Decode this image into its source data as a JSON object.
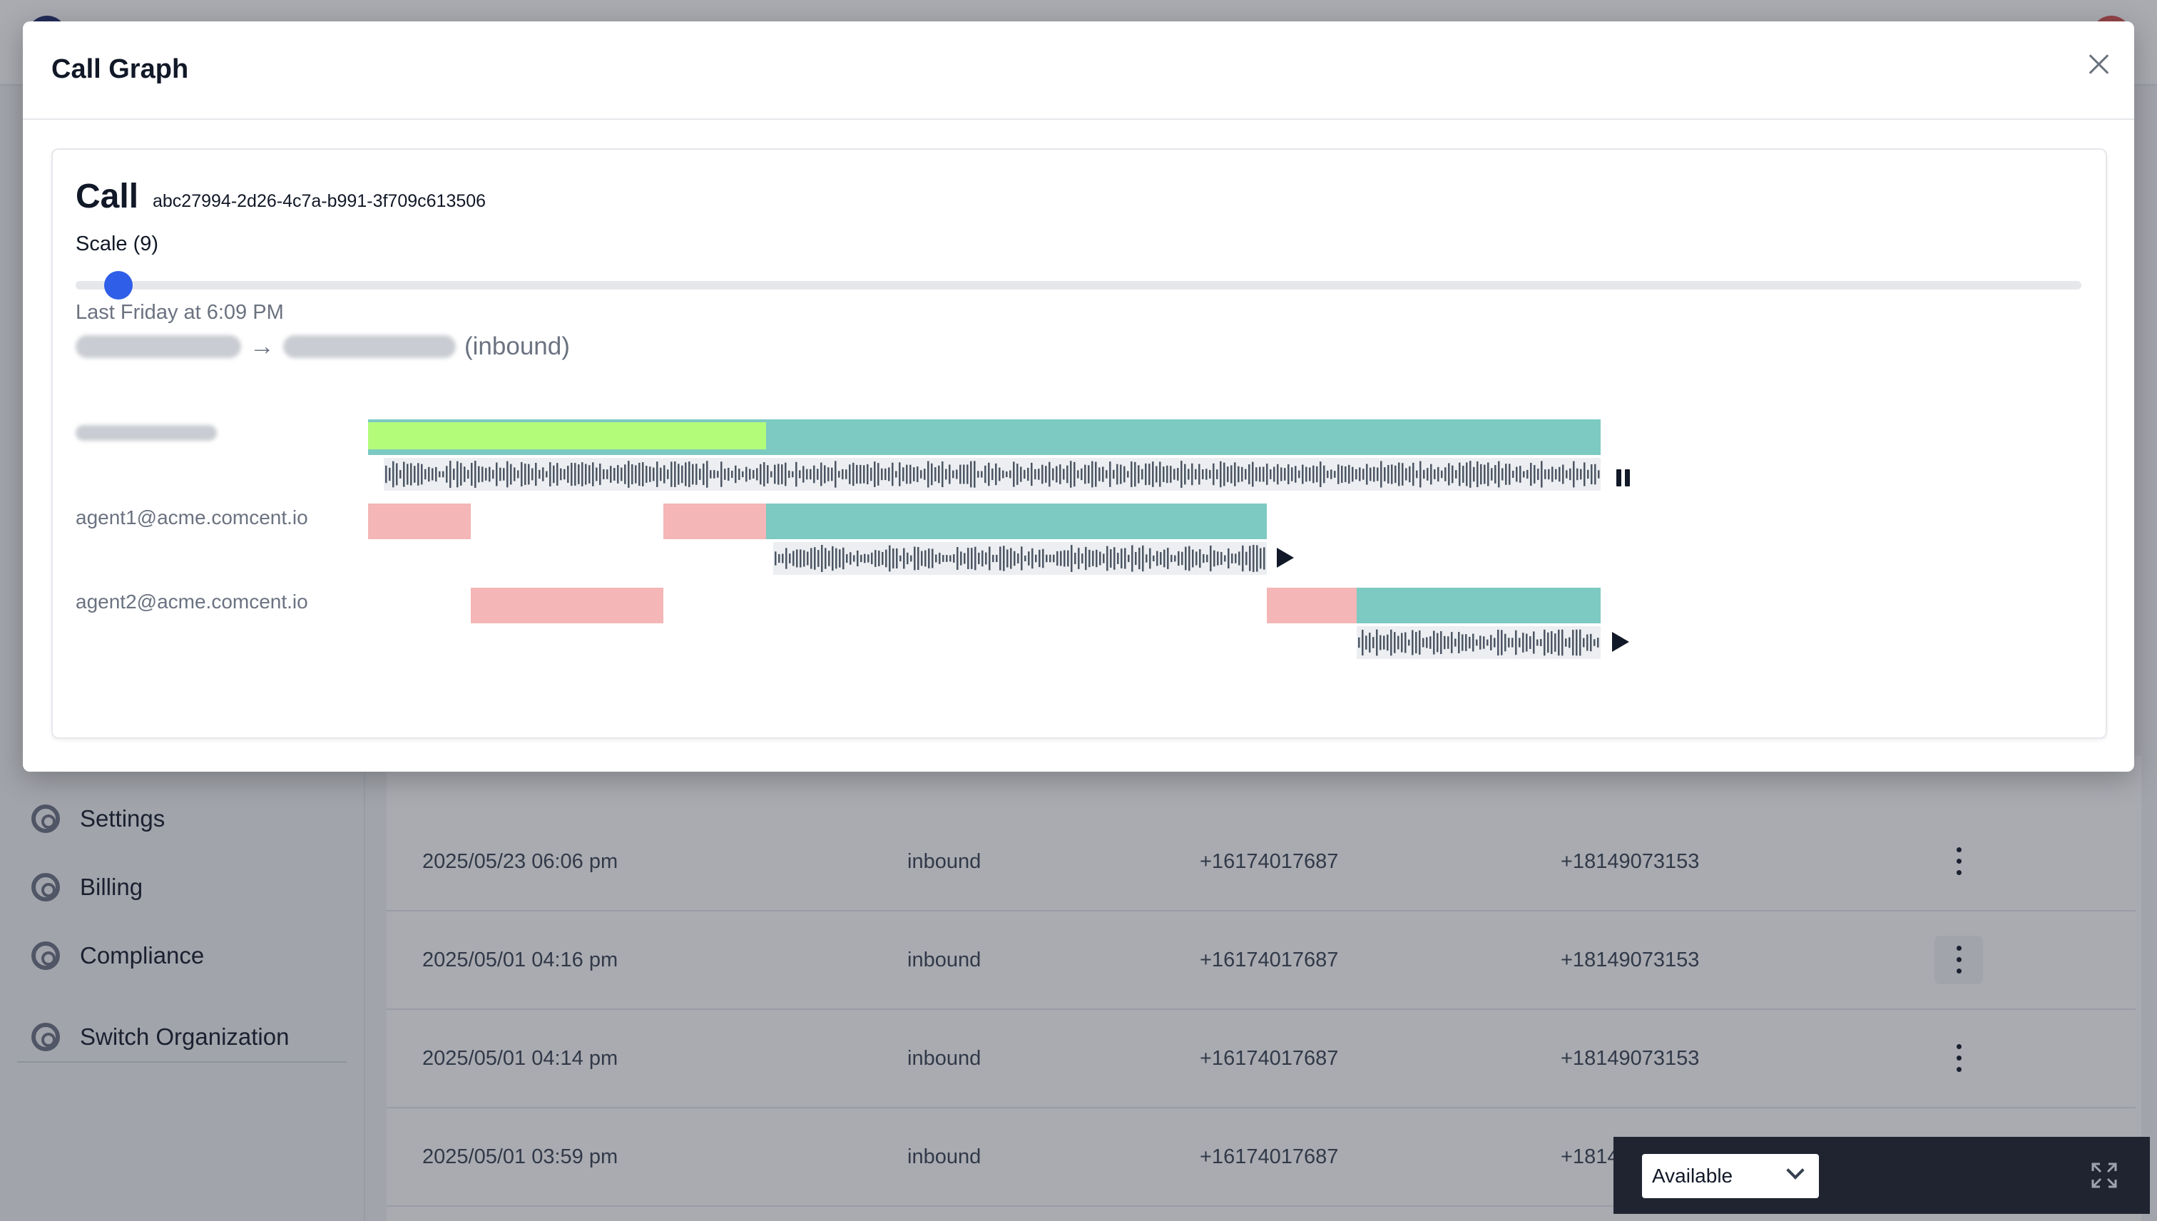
{
  "sidebar": {
    "items": [
      {
        "label": "Settings",
        "icon": "lifebuoy-icon"
      },
      {
        "label": "Billing",
        "icon": "lifebuoy-icon"
      },
      {
        "label": "Compliance",
        "icon": "lifebuoy-icon"
      },
      {
        "label": "Switch Organization",
        "icon": "lifebuoy-icon"
      }
    ]
  },
  "calls_table": {
    "rows": [
      {
        "date": "2025/05/23 06:06 pm",
        "direction": "inbound",
        "from": "+16174017687",
        "to": "+18149073153"
      },
      {
        "date": "2025/05/01 04:16 pm",
        "direction": "inbound",
        "from": "+16174017687",
        "to": "+18149073153"
      },
      {
        "date": "2025/05/01 04:14 pm",
        "direction": "inbound",
        "from": "+16174017687",
        "to": "+18149073153"
      },
      {
        "date": "2025/05/01 03:59 pm",
        "direction": "inbound",
        "from": "+16174017687",
        "to": "+1814"
      }
    ]
  },
  "status_widget": {
    "selected": "Available",
    "expand_icon": "expand-icon"
  },
  "modal": {
    "title": "Call Graph",
    "close_icon": "close-icon",
    "call_label": "Call",
    "call_id": "abc27994-2d26-4c7a-b991-3f709c613506",
    "scale_label": "Scale (9)",
    "scale_value": 9,
    "call_time": "Last Friday at 6:09 PM",
    "route_arrow": "→",
    "route_direction": "(inbound)",
    "participants": [
      {
        "label": "",
        "redacted": true,
        "audio_state": "playing"
      },
      {
        "label": "agent1@acme.comcent.io",
        "redacted": false,
        "audio_state": "paused"
      },
      {
        "label": "agent2@acme.comcent.io",
        "redacted": false,
        "audio_state": "paused"
      }
    ],
    "colors": {
      "talking": "#7ccac2",
      "ringing": "#f4b6b6",
      "ivr": "#b3fc7a",
      "slider": "#2f5ee8"
    }
  }
}
